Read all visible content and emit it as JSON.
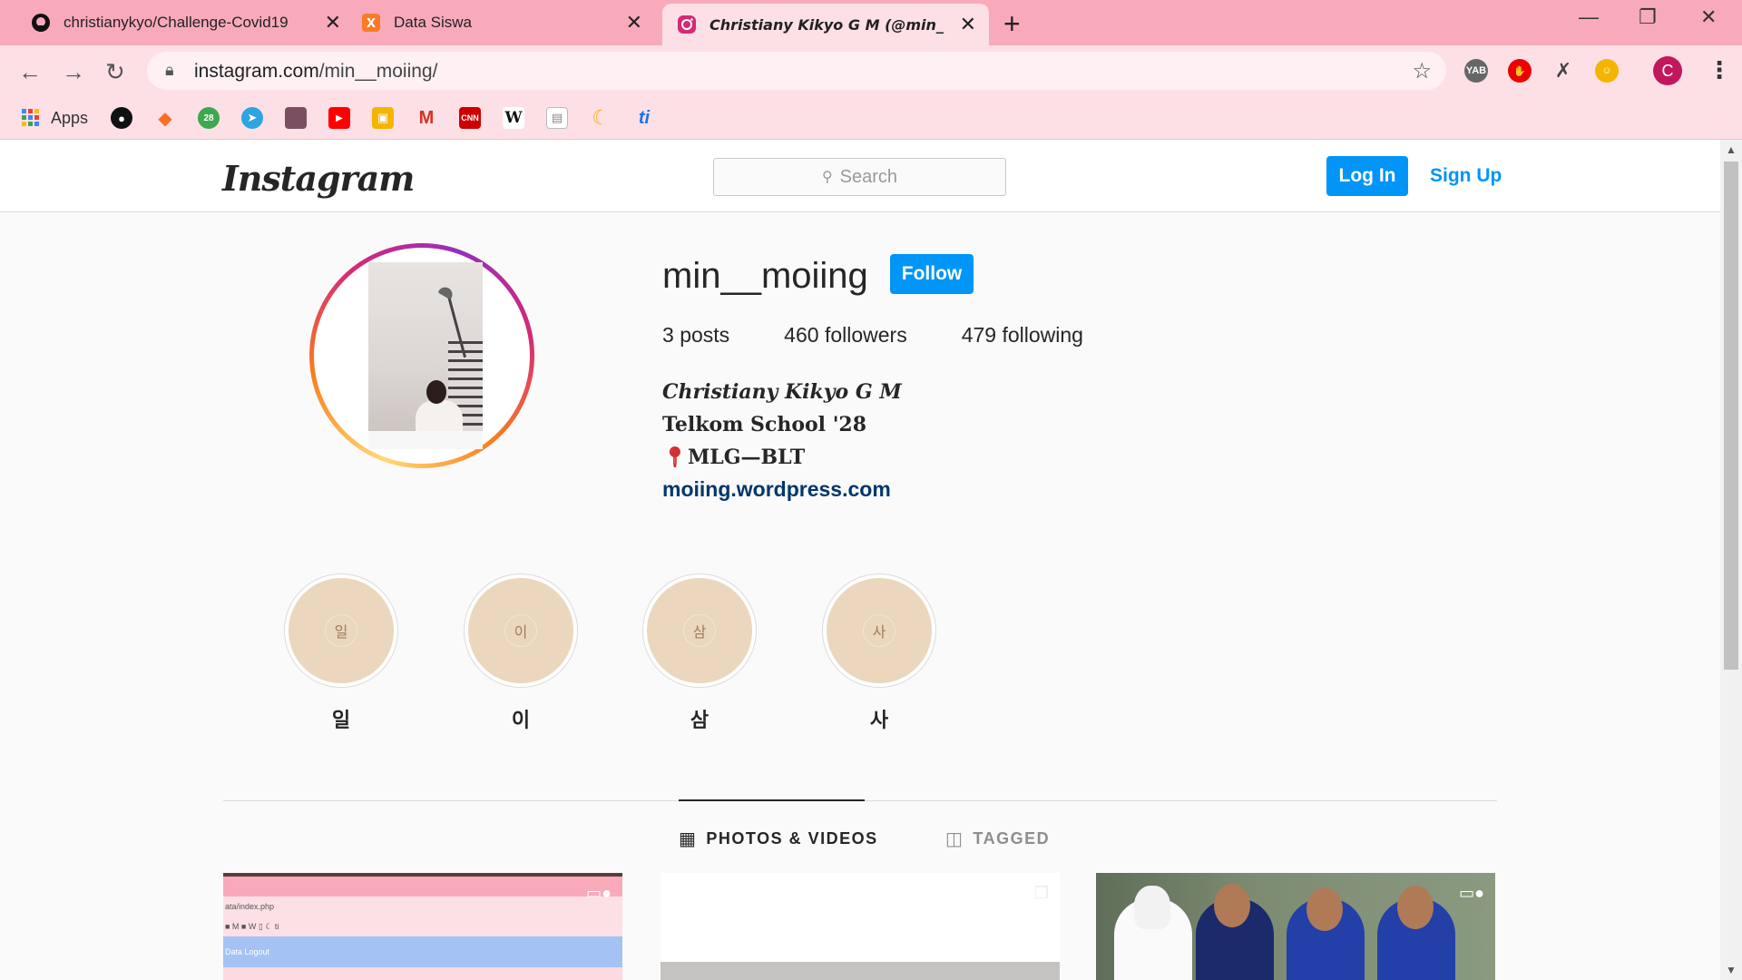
{
  "browser": {
    "tabs": [
      {
        "title": "christianykyo/Challenge-Covid19",
        "icon": "github-icon",
        "close": "✕"
      },
      {
        "title": "Data Siswa",
        "icon": "xampp-icon",
        "close": "✕"
      },
      {
        "title": "Christiany Kikyo G M (@min_",
        "icon": "instagram-icon",
        "close": "✕"
      }
    ],
    "new_tab": "+",
    "url_domain": "instagram.com",
    "url_path": "/min__moiing/",
    "profile_initial": "C",
    "bookmarks_apps_label": "Apps",
    "extension_labels": {
      "yab": "YAB"
    }
  },
  "instagram": {
    "logo": "Instagram",
    "search_placeholder": "Search",
    "login": "Log In",
    "signup": "Sign Up",
    "profile": {
      "username": "min__moiing",
      "follow": "Follow",
      "posts_count": "3",
      "posts_label": "posts",
      "followers_count": "460",
      "followers_label": "followers",
      "following_count": "479",
      "following_label": "following",
      "full_name": "Christiany Kikyo G M",
      "bio_line1": "Telkom School '28",
      "bio_line2": "MLG—BLT",
      "link": "moiing.wordpress.com"
    },
    "highlights": [
      {
        "label": "일",
        "cover": "일"
      },
      {
        "label": "이",
        "cover": "이"
      },
      {
        "label": "삼",
        "cover": "삼"
      },
      {
        "label": "사",
        "cover": "사"
      }
    ],
    "tabs": {
      "photos": "PHOTOS & VIDEOS",
      "tagged": "TAGGED"
    },
    "thumb1_texts": {
      "line_a": "ata/index.php",
      "line_b": "Data   Logout"
    }
  },
  "colors": {
    "accent": "#0095f6",
    "tabstrip": "#f8aabb",
    "toolbar": "#fde0e6",
    "highlight_fill": "#ead7bd"
  }
}
